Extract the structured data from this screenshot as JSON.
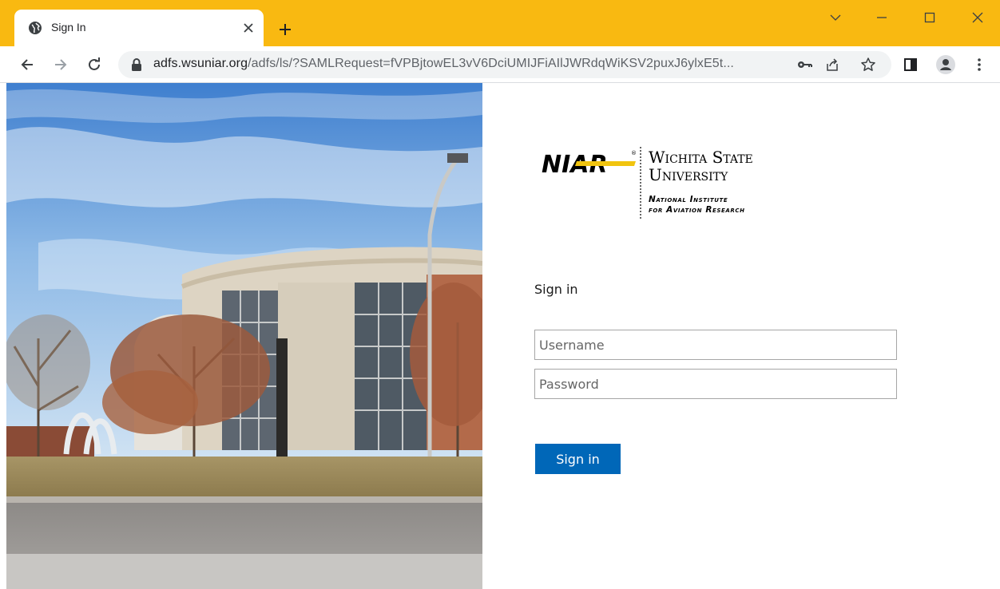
{
  "browser": {
    "tab_title": "Sign In",
    "url_host": "adfs.wsuniar.org",
    "url_path": "/adfs/ls/?SAMLRequest=fVPBjtowEL3vV6DciUMIJFiAIlJWRdqWiKSV2puxJ6ylxE5t...",
    "colors": {
      "frame": "#f9b911",
      "toolbar": "#ffffff",
      "omnibox": "#f1f3f4"
    },
    "icons": [
      "globe-icon",
      "close-icon",
      "plus-icon",
      "chevron-down-icon",
      "minimize-icon",
      "maximize-icon",
      "close-window-icon",
      "back-arrow-icon",
      "forward-arrow-icon",
      "reload-icon",
      "lock-icon",
      "key-icon",
      "share-icon",
      "star-icon",
      "side-panel-icon",
      "profile-icon",
      "kebab-menu-icon"
    ]
  },
  "logo": {
    "brand": "NIAR",
    "line1": "Wichita State",
    "line2": "University",
    "line3": "National Institute",
    "line4": "for Aviation Research"
  },
  "form": {
    "heading": "Sign in",
    "username_placeholder": "Username",
    "username_value": "",
    "password_placeholder": "Password",
    "password_value": "",
    "submit_label": "Sign in",
    "accent_color": "#0067b8"
  }
}
